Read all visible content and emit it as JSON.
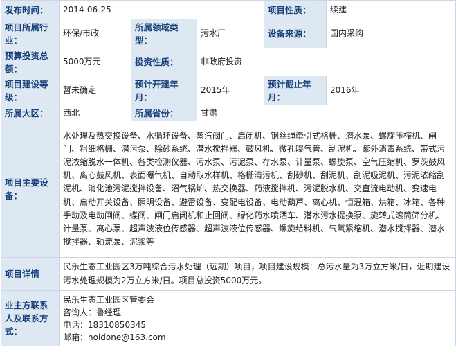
{
  "rows": {
    "publish_time": {
      "label": "发布时间：",
      "value": "2014-06-25"
    },
    "project_nature": {
      "label": "项目性质：",
      "value": "续建"
    },
    "industry": {
      "label": "项目所属行业：",
      "value": "环保/市政"
    },
    "field_type": {
      "label": "所属领域类型：",
      "value": "污水厂"
    },
    "equipment_source": {
      "label": "设备来源：",
      "value": "国内采购"
    },
    "budget": {
      "label": "预算投资总额：",
      "value": "5000万元"
    },
    "investment_nature": {
      "label": "投资性质：",
      "value": "非政府投资"
    },
    "construction_stage": {
      "label": "项目建设等级：",
      "value": "暂未确定"
    },
    "start_year": {
      "label": "预计开建年月：",
      "value": "2015年"
    },
    "end_year": {
      "label": "预计截止年月：",
      "value": "2016年"
    },
    "region": {
      "label": "所属大区：",
      "value": "西北"
    },
    "province": {
      "label": "所属省份：",
      "value": "甘肃"
    },
    "main_equipment": {
      "label": "项目主要设备：",
      "value": "水处理及热交换设备、水循环设备、蒸汽阀门、启闭机、钢丝绳牵引式格栅、潜水泵、螺旋压榨机、闸门、粗细格栅、潜污泵、除砂系统、潜水搅拌器、鼓风机、微孔曝气管、刮泥机、紫外消毒系统、带式污泥浓缩脱水一体机、各类检测仪器、污水泵、污泥泵、存水泵、计量泵、螺旋泵、空气压缩机、罗茨鼓风机、离心鼓风机、表面曝气机、自动取水样机、格栅清污机、刮砂机、刮泥机、刮泥吸泥机、污泥浓缩刮泥机、消化池污泥搅拌设备、沼气锅炉、热交换器、药液搅拌机、污泥脱水机、交直流电动机、变速电机、启动开关设备、照明设备、避雷设备、变配电设备、电动葫芦、离心机、恒温箱、烘箱、冰箱、各种手动及电动闸阀、蝶阀、闸门启闭机和止回阀、绿化药水喷洒车、潜水污水提换泵、旋转式滚筒筛分机、计量泵、离心泵、超声波液位传感器、超声波液位传感器、螺旋给料机、气氧紧缩机、潜水搅拌器、潜水搅拌器、轴流泵、泥浆等"
    },
    "project_detail": {
      "label": "项目详情",
      "value": "民乐生态工业园区3万吨综合污水处理（远期）项目，项目建设规模：总污水量为3万立方米/日，近期建设污水处理规模为2万立方米/日。项目总投资5000万元。"
    },
    "contact": {
      "label": "业主方联系人及联系方式：",
      "org": "民乐生态工业园区管委会",
      "person": "咨询人：鲁经理",
      "phone": "电话：18310850345",
      "email": "邮箱：holdone@163.com"
    }
  }
}
